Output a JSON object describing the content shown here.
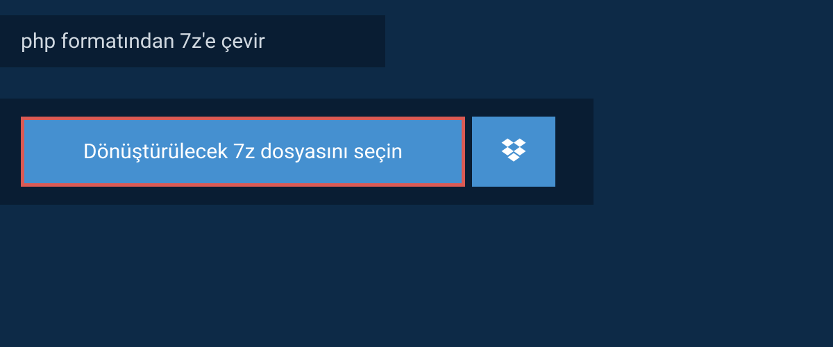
{
  "header": {
    "title": "php formatından 7z'e çevir"
  },
  "upload": {
    "select_button_label": "Dönüştürülecek 7z dosyasını seçin"
  },
  "colors": {
    "page_bg": "#0d2a47",
    "panel_bg": "#091d33",
    "button_bg": "#4590d0",
    "button_border": "#db5a54",
    "text_light": "#d0d8e0",
    "text_white": "#ffffff"
  }
}
